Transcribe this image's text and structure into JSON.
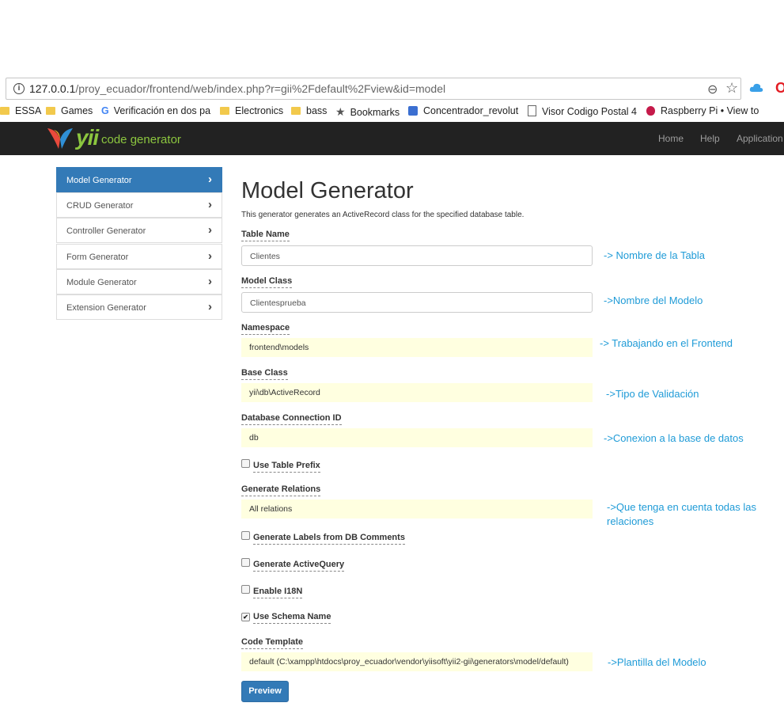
{
  "browser": {
    "url_host": "127.0.0.1",
    "url_rest": "/proy_ecuador/frontend/web/index.php?r=gii%2Fdefault%2Fview&id=model",
    "info_icon": "info-icon",
    "zoom_icon": "zoom-out-icon",
    "star_icon": "bookmark-star-icon"
  },
  "bookmarks": [
    {
      "label": "ESSA",
      "icon": "folder-icon"
    },
    {
      "label": "Games",
      "icon": "folder-icon"
    },
    {
      "label": "Verificación en dos pa",
      "icon": "google-icon"
    },
    {
      "label": "Electronics",
      "icon": "folder-icon"
    },
    {
      "label": "bass",
      "icon": "folder-icon"
    },
    {
      "label": "Bookmarks",
      "icon": "star-icon"
    },
    {
      "label": "Concentrador_revolut",
      "icon": "app-icon"
    },
    {
      "label": "Visor Codigo Postal 4",
      "icon": "document-icon"
    },
    {
      "label": "Raspberry Pi • View to",
      "icon": "raspberry-icon"
    }
  ],
  "navbar": {
    "logo_yii": "yii",
    "logo_text": "code generator",
    "links": [
      "Home",
      "Help",
      "Application"
    ]
  },
  "sidebar": {
    "items": [
      {
        "label": "Model Generator",
        "active": true
      },
      {
        "label": "CRUD Generator",
        "active": false
      },
      {
        "label": "Controller Generator",
        "active": false
      },
      {
        "label": "Form Generator",
        "active": false
      },
      {
        "label": "Module Generator",
        "active": false
      },
      {
        "label": "Extension Generator",
        "active": false
      }
    ]
  },
  "main": {
    "title": "Model Generator",
    "description": "This generator generates an ActiveRecord class for the specified database table.",
    "fields": {
      "table_name": {
        "label": "Table Name",
        "value": "Clientes"
      },
      "model_class": {
        "label": "Model Class",
        "value": "Clientesprueba"
      },
      "namespace": {
        "label": "Namespace",
        "value": "frontend\\models"
      },
      "base_class": {
        "label": "Base Class",
        "value": "yii\\db\\ActiveRecord"
      },
      "db_connection": {
        "label": "Database Connection ID",
        "value": "db"
      },
      "use_table_prefix": {
        "label": "Use Table Prefix",
        "checked": false
      },
      "generate_relations": {
        "label": "Generate Relations",
        "value": "All relations"
      },
      "labels_from_db": {
        "label": "Generate Labels from DB Comments",
        "checked": false
      },
      "generate_activequery": {
        "label": "Generate ActiveQuery",
        "checked": false
      },
      "enable_i18n": {
        "label": "Enable I18N",
        "checked": false
      },
      "use_schema_name": {
        "label": "Use Schema Name",
        "checked": true
      },
      "code_template": {
        "label": "Code Template",
        "value": "default (C:\\xampp\\htdocs\\proy_ecuador\\vendor\\yiisoft\\yii2-gii\\generators\\model/default)"
      }
    },
    "preview_label": "Preview"
  },
  "annotations": {
    "table": "-> Nombre de la Tabla",
    "model": "->Nombre del Modelo",
    "frontend": "-> Trabajando en el Frontend",
    "validation": "->Tipo de Validación",
    "connection": "->Conexion a la base de datos",
    "relations_1": "->Que tenga en cuenta todas las",
    "relations_2": "relaciones",
    "template": "->Plantilla del Modelo"
  },
  "colors": {
    "navbar_bg": "#222222",
    "primary": "#337ab7",
    "sticky_bg": "#ffffe0",
    "annotation": "#1f9bd7",
    "logo_green": "#8cc63f"
  }
}
